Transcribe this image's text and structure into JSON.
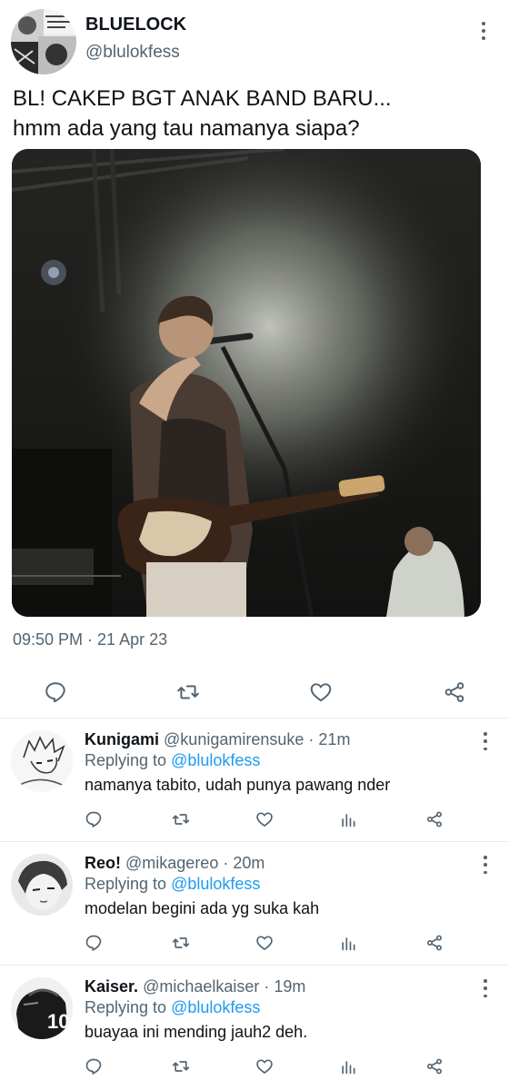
{
  "main_tweet": {
    "display_name": "BLUELOCK",
    "handle": "@blulokfess",
    "text": "BL! CAKEP BGT ANAK BAND BARU...\nhmm ada yang tau namanya siapa?",
    "timestamp": "09:50 PM · 21 Apr 23",
    "avatar": "manga-collage-avatar",
    "photo": "concert-photo-singer-with-guitar",
    "actions": [
      "reply-icon",
      "retweet-icon",
      "like-icon",
      "share-icon"
    ]
  },
  "replies": [
    {
      "name": "Kunigami",
      "handle": "@kunigamirensuke",
      "dot": "·",
      "time": "21m",
      "replying_prefix": "Replying to ",
      "replying_to": "@blulokfess",
      "text": "namanya tabito, udah punya pawang nder",
      "avatar": "manga-sketch-avatar"
    },
    {
      "name": "Reo!",
      "handle": "@mikagereo",
      "dot": "·",
      "time": "20m",
      "replying_prefix": "Replying to ",
      "replying_to": "@blulokfess",
      "text": "modelan begini ada yg suka kah",
      "avatar": "manga-face-avatar"
    },
    {
      "name": "Kaiser.",
      "handle": "@michaelkaiser",
      "dot": "·",
      "time": "19m",
      "replying_prefix": "Replying to ",
      "replying_to": "@blulokfess",
      "text": "buayaa ini mending jauh2 deh.",
      "avatar": "jersey-number-10-avatar"
    }
  ],
  "colors": {
    "text": "#0f1419",
    "secondary": "#536471",
    "link": "#1d9bf0",
    "divider": "#e6ecf0"
  }
}
